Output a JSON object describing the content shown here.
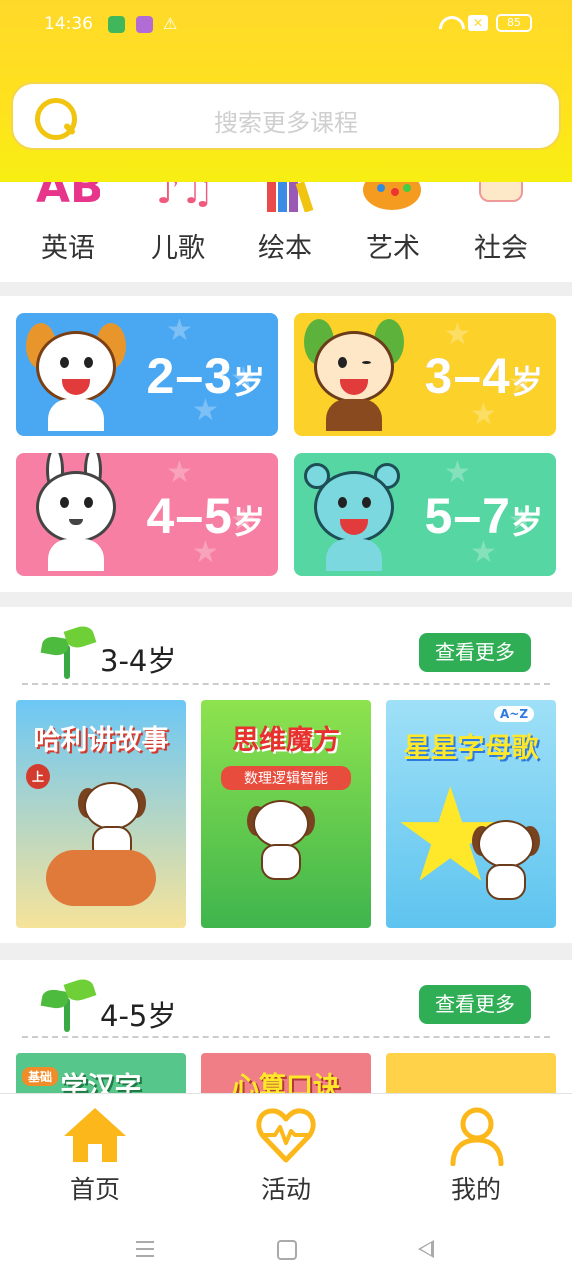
{
  "status_bar": {
    "time": "14:36",
    "warning_glyph": "⚠",
    "sim_glyph": "✕",
    "battery": "85"
  },
  "search": {
    "placeholder": "搜索更多课程"
  },
  "categories": [
    {
      "label": "英语",
      "icon": "letters-icon"
    },
    {
      "label": "儿歌",
      "icon": "music-note-icon"
    },
    {
      "label": "绘本",
      "icon": "books-icon"
    },
    {
      "label": "艺术",
      "icon": "palette-icon"
    },
    {
      "label": "社会",
      "icon": "drum-icon"
    }
  ],
  "age_groups": [
    {
      "range": "2–3",
      "unit": "岁",
      "color": "#4aa8f3"
    },
    {
      "range": "3–4",
      "unit": "岁",
      "color": "#fcd22a"
    },
    {
      "range": "4–5",
      "unit": "岁",
      "color": "#f77fa3"
    },
    {
      "range": "5–7",
      "unit": "岁",
      "color": "#56d6a3"
    }
  ],
  "sections": [
    {
      "title": "3-4岁",
      "more_label": "查看更多",
      "courses": [
        {
          "title": "哈利讲故事",
          "badge": "上"
        },
        {
          "title": "思维魔方",
          "subtitle": "数理逻辑智能"
        },
        {
          "title": "星星字母歌",
          "badge": "A~Z"
        }
      ]
    },
    {
      "title": "4-5岁",
      "more_label": "查看更多",
      "courses": [
        {
          "title": "学汉字",
          "badge": "基础"
        },
        {
          "title": "心算口诀"
        },
        {
          "title": ""
        }
      ]
    }
  ],
  "bottom_nav": [
    {
      "label": "首页",
      "icon": "home-icon",
      "active": true
    },
    {
      "label": "活动",
      "icon": "heart-pulse-icon",
      "active": false
    },
    {
      "label": "我的",
      "icon": "user-icon",
      "active": false
    }
  ],
  "colors": {
    "header": "#ffd92a",
    "accent": "#fcb71b",
    "more_button": "#2fae55"
  }
}
